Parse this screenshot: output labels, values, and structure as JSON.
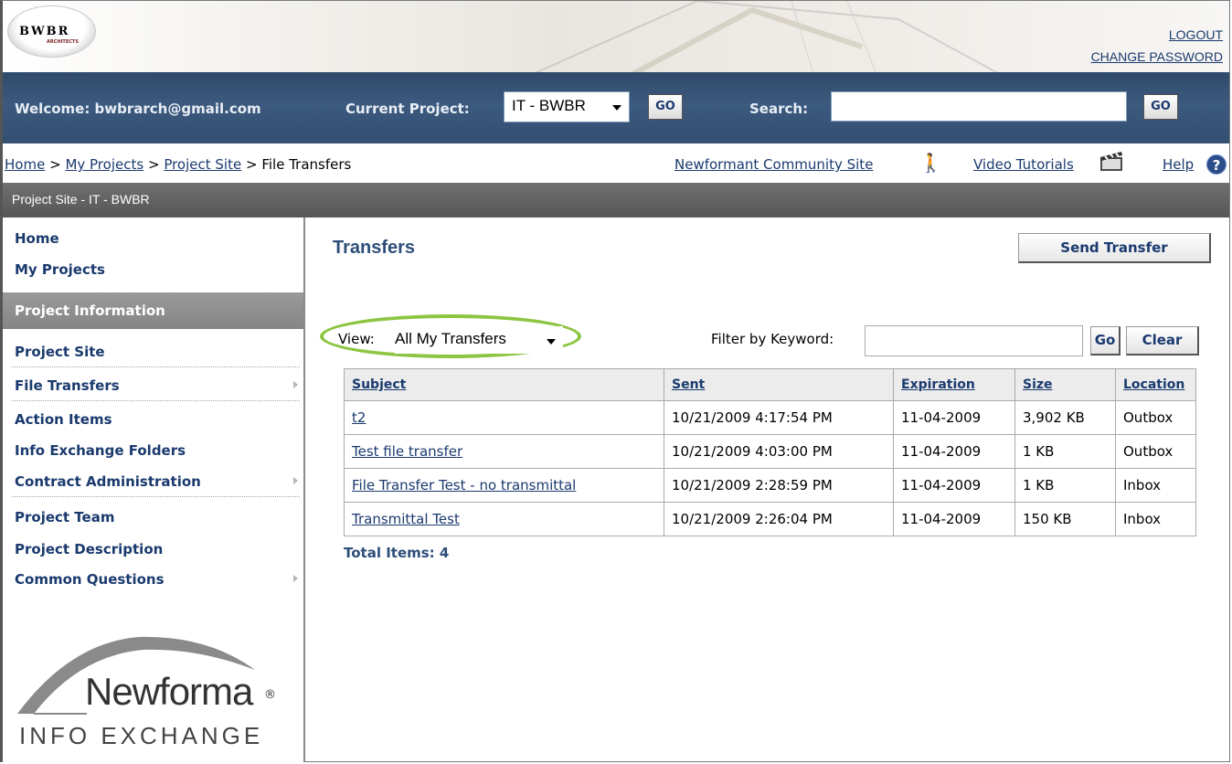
{
  "banner": {
    "logo_text": "BWBR",
    "logo_sub": "ARCHITECTS",
    "logout": "LOGOUT",
    "change_password": "CHANGE PASSWORD"
  },
  "topbar": {
    "welcome": "Welcome: bwbrarch@gmail.com",
    "current_project_label": "Current Project:",
    "current_project_value": "IT - BWBR",
    "go": "GO",
    "search_label": "Search:",
    "search_value": ""
  },
  "breadcrumb": {
    "home": "Home",
    "my_projects": "My Projects",
    "project_site": "Project Site",
    "current": "File Transfers",
    "separator": ">"
  },
  "links": {
    "community": "Newformant Community Site",
    "videos": "Video Tutorials",
    "help": "Help"
  },
  "site_header": "Project Site - IT - BWBR",
  "sidebar": {
    "home": "Home",
    "my_projects": "My Projects",
    "section": "Project Information",
    "items": [
      {
        "label": "Project Site",
        "arrow": false
      },
      {
        "label": "File Transfers",
        "arrow": true
      },
      {
        "label": "Action Items",
        "arrow": false
      },
      {
        "label": "Info Exchange Folders",
        "arrow": false
      },
      {
        "label": "Contract Administration",
        "arrow": true
      },
      {
        "label": "Project Team",
        "arrow": false
      },
      {
        "label": "Project Description",
        "arrow": false
      },
      {
        "label": "Common Questions",
        "arrow": true
      }
    ],
    "logo_name": "Newforma",
    "logo_registered": "®",
    "logo_tagline": "INFO EXCHANGE"
  },
  "main": {
    "title": "Transfers",
    "send_button": "Send Transfer",
    "view_label": "View:",
    "view_value": "All My Transfers",
    "filter_label": "Filter by Keyword:",
    "filter_value": "",
    "go_button": "Go",
    "clear_button": "Clear",
    "columns": [
      "Subject",
      "Sent",
      "Expiration",
      "Size",
      "Location"
    ],
    "rows": [
      {
        "subject": "t2",
        "sent": "10/21/2009 4:17:54 PM",
        "expiration": "11-04-2009",
        "size": "3,902 KB",
        "location": "Outbox"
      },
      {
        "subject": "Test file transfer",
        "sent": "10/21/2009 4:03:00 PM",
        "expiration": "11-04-2009",
        "size": "1 KB",
        "location": "Outbox"
      },
      {
        "subject": "File Transfer Test - no transmittal",
        "sent": "10/21/2009 2:28:59 PM",
        "expiration": "11-04-2009",
        "size": "1 KB",
        "location": "Inbox"
      },
      {
        "subject": "Transmittal Test",
        "sent": "10/21/2009 2:26:04 PM",
        "expiration": "11-04-2009",
        "size": "150 KB",
        "location": "Inbox"
      }
    ],
    "total": "Total Items: 4"
  },
  "colors": {
    "navy_bar": "#3c5a7e",
    "link": "#1a3a6e",
    "highlight_ring": "#8cc542"
  }
}
